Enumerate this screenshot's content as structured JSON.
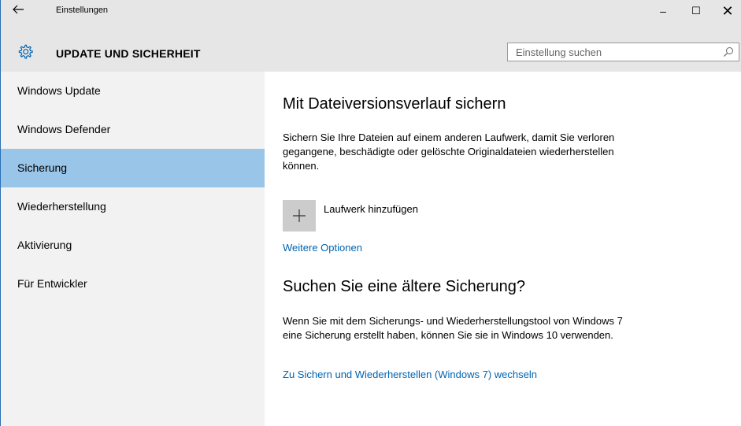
{
  "window": {
    "title": "Einstellungen",
    "back_icon": "back-arrow-icon",
    "controls": {
      "minimize": "–",
      "maximize": "☐",
      "close": "✕"
    }
  },
  "header": {
    "icon": "gear-icon",
    "title": "UPDATE UND SICHERHEIT",
    "search_placeholder": "Einstellung suchen",
    "search_icon": "search-icon"
  },
  "sidebar": {
    "items": [
      {
        "label": "Windows Update"
      },
      {
        "label": "Windows Defender"
      },
      {
        "label": "Sicherung",
        "active": true
      },
      {
        "label": "Wiederherstellung"
      },
      {
        "label": "Aktivierung"
      },
      {
        "label": "Für Entwickler"
      }
    ]
  },
  "main": {
    "backup_title": "Mit Dateiversionsverlauf sichern",
    "backup_description": "Sichern Sie Ihre Dateien auf einem anderen Laufwerk, damit Sie verloren gegangene, beschädigte oder gelöschte Originaldateien wiederherstellen können.",
    "add_drive_icon": "plus-icon",
    "add_drive_label": "Laufwerk hinzufügen",
    "more_options_link": "Weitere Optionen",
    "older_title": "Suchen Sie eine ältere Sicherung?",
    "older_description": "Wenn Sie mit dem Sicherungs- und Wiederherstellungstool von Windows 7 eine Sicherung erstellt haben, können Sie sie in Windows 10 verwenden.",
    "win7_link": "Zu Sichern und Wiederherstellen (Windows 7) wechseln"
  },
  "colors": {
    "accent": "#0063b1",
    "selected_nav": "#99c5e8",
    "chrome": "#e6e6e6",
    "sidebar_bg": "#f2f2f2"
  }
}
